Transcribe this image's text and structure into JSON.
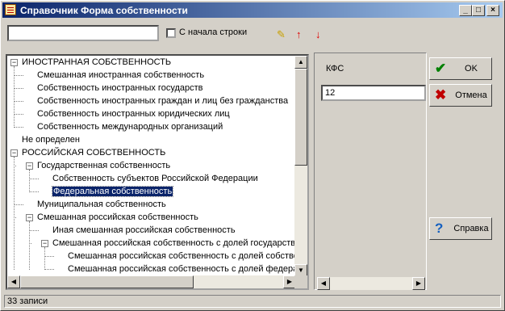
{
  "window": {
    "title": "Справочник Форма собственности"
  },
  "titlebar_buttons": {
    "minimize": "_",
    "maximize": "□",
    "close": "×"
  },
  "toolbar": {
    "search": {
      "value": "",
      "placeholder": ""
    },
    "from_start_label": "С начала строки",
    "from_start_checked": false,
    "icons": {
      "find": "✎",
      "up": "↑",
      "down": "↓"
    }
  },
  "tree": {
    "items": [
      {
        "label": "ИНОСТРАННАЯ СОБСТВЕННОСТЬ",
        "level": 0,
        "expander": "−"
      },
      {
        "label": "Смешанная иностранная собственность",
        "level": 1
      },
      {
        "label": "Собственность иностранных государств",
        "level": 1
      },
      {
        "label": "Собственность иностранных граждан и лиц без гражданства",
        "level": 1
      },
      {
        "label": "Собственность иностранных юридических лиц",
        "level": 1
      },
      {
        "label": "Собственность международных организаций",
        "level": 1
      },
      {
        "label": "Не определен",
        "level": 0
      },
      {
        "label": "РОССИЙСКАЯ СОБСТВЕННОСТЬ",
        "level": 0,
        "expander": "−"
      },
      {
        "label": "Государственная собственность",
        "level": 1,
        "expander": "−"
      },
      {
        "label": "Собственность субъектов Российской Федерации",
        "level": 2
      },
      {
        "label": "Федеральная собственность",
        "level": 2,
        "selected": true
      },
      {
        "label": "Муниципальная собственность",
        "level": 1
      },
      {
        "label": "Смешанная российская собственность",
        "level": 1,
        "expander": "−"
      },
      {
        "label": "Иная смешанная российская собственность",
        "level": 2
      },
      {
        "label": "Смешанная российская собственность с долей государстве",
        "level": 2,
        "expander": "−"
      },
      {
        "label": "Смешанная российская собственность с долей собстве",
        "level": 3
      },
      {
        "label": "Смешанная российская собственность с долей федера",
        "level": 3
      }
    ]
  },
  "scroll": {
    "up": "▲",
    "down": "▼",
    "left": "◀",
    "right": "▶"
  },
  "detail": {
    "kfs_label": "КФС",
    "kfs_value": "12"
  },
  "buttons": {
    "ok": {
      "label": "OK",
      "icon": "✔"
    },
    "cancel": {
      "label": "Отмена",
      "icon": "✖"
    },
    "help": {
      "label": "Справка",
      "icon": "?"
    }
  },
  "status": {
    "text": "33 записи"
  },
  "colors": {
    "ok": "#008000",
    "cancel": "#c00000",
    "help": "#1560c0",
    "arrows": "#e00000",
    "find": "#c8a000"
  }
}
